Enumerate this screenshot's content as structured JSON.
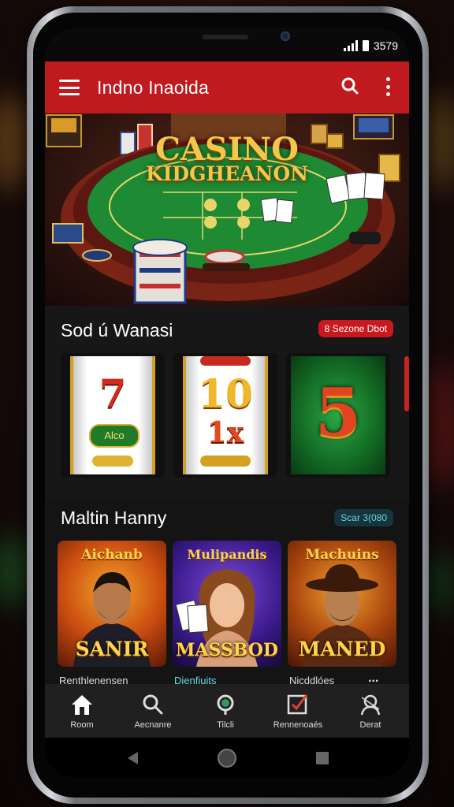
{
  "status": {
    "time": "3579"
  },
  "appbar": {
    "title": "Indno Inaoida"
  },
  "hero": {
    "title_line1": "CASINO",
    "title_line2": "KIDGHEANON"
  },
  "section1": {
    "title": "Sod ú Wanasi",
    "badge": "8 Sezone Dbot"
  },
  "reels": [
    {
      "symbol": "7",
      "sub": "Alco"
    },
    {
      "symbol": "10",
      "sub": "1x"
    },
    {
      "symbol": "5",
      "sub": ""
    }
  ],
  "section2": {
    "title": "Maltin Hanny",
    "badge": "Scar 3(080"
  },
  "games": [
    {
      "head": "Aichanb",
      "foot": "SANIR",
      "label": "Renthlenensen"
    },
    {
      "head": "Mulipandis",
      "foot": "MASSBOD",
      "label": "Dienfiuits"
    },
    {
      "head": "Machuins",
      "foot": "MANED",
      "label": "Nicddlóes"
    }
  ],
  "more_label": "...",
  "nav": [
    {
      "label": "Room",
      "icon": "home-icon"
    },
    {
      "label": "Aecnanre",
      "icon": "search-icon"
    },
    {
      "label": "Tilcli",
      "icon": "search-active-icon"
    },
    {
      "label": "Rennenoaés",
      "icon": "checklist-icon"
    },
    {
      "label": "Derat",
      "icon": "profile-icon"
    }
  ],
  "colors": {
    "accent": "#c01a1f",
    "gold": "#f6c64a",
    "felt": "#1f8a34",
    "badge_teal": "#6ad8e8"
  }
}
